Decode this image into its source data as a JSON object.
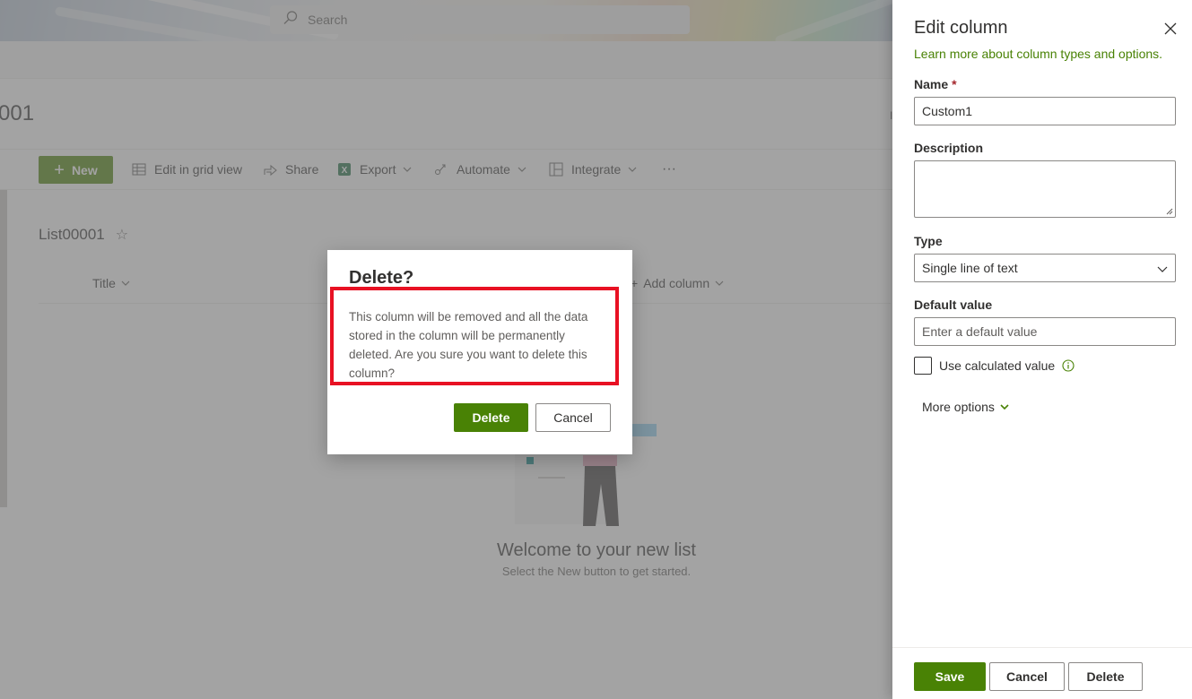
{
  "search": {
    "placeholder": "Search"
  },
  "site": {
    "title_partial": "001"
  },
  "commandbar": {
    "new_label": "New",
    "edit_grid_label": "Edit in grid view",
    "share_label": "Share",
    "export_label": "Export",
    "automate_label": "Automate",
    "integrate_label": "Integrate",
    "more_label": "···"
  },
  "list": {
    "title": "List00001",
    "columns": [
      {
        "label": "Title"
      },
      {
        "label": "Add column"
      }
    ],
    "empty_heading": "Welcome to your new list",
    "empty_sub": "Select the New button to get started."
  },
  "dialog": {
    "title": "Delete?",
    "body": "This column will be removed and all the data stored in the column will be permanently deleted. Are you sure you want to delete this column?",
    "confirm_label": "Delete",
    "cancel_label": "Cancel",
    "highlight_color": "#e81123"
  },
  "panel": {
    "title": "Edit column",
    "learn_link": "Learn more about column types and options.",
    "name_label": "Name",
    "name_required": "*",
    "name_value": "Custom1",
    "description_label": "Description",
    "description_value": "",
    "type_label": "Type",
    "type_value": "Single line of text",
    "default_label": "Default value",
    "default_placeholder": "Enter a default value",
    "calculated_label": "Use calculated value",
    "more_options_label": "More options",
    "save_label": "Save",
    "cancel_label": "Cancel",
    "delete_label": "Delete"
  },
  "theme": {
    "accent": "#498205",
    "text": "#323130",
    "subtle": "#605e5c"
  }
}
